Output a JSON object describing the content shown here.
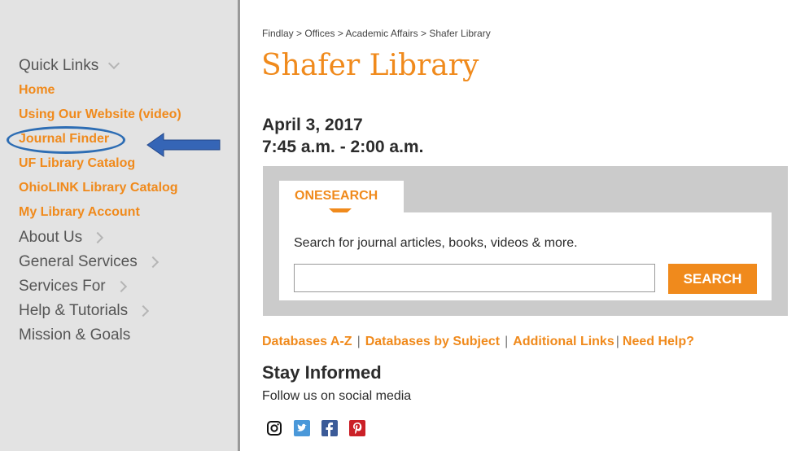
{
  "sidebar": {
    "quick_links": "Quick Links",
    "links": [
      "Home",
      "Using Our Website (video)",
      "Journal Finder",
      "UF Library Catalog",
      "OhioLINK Library Catalog",
      "My Library Account"
    ],
    "sections": [
      "About Us",
      "General Services",
      "Services For",
      "Help & Tutorials",
      "Mission & Goals"
    ]
  },
  "breadcrumb": "Findlay > Offices > Academic Affairs > Shafer Library",
  "title": "Shafer Library",
  "hours": {
    "date": "April 3, 2017",
    "time": "7:45 a.m. - 2:00 a.m."
  },
  "search": {
    "tab_label": "ONESEARCH",
    "hint": "Search for journal articles, books, videos & more.",
    "input_value": "",
    "button_label": "SEARCH"
  },
  "links": [
    "Databases A-Z",
    "Databases by Subject",
    "Additional Links",
    "Need Help?"
  ],
  "stay_informed": {
    "title": "Stay Informed",
    "subtitle": "Follow us on social media"
  },
  "social": [
    "instagram-icon",
    "twitter-icon",
    "facebook-icon",
    "pinterest-icon"
  ],
  "colors": {
    "accent": "#f08a1c",
    "annotation": "#2d6db4",
    "sidebar_bg": "#e3e3e3"
  }
}
